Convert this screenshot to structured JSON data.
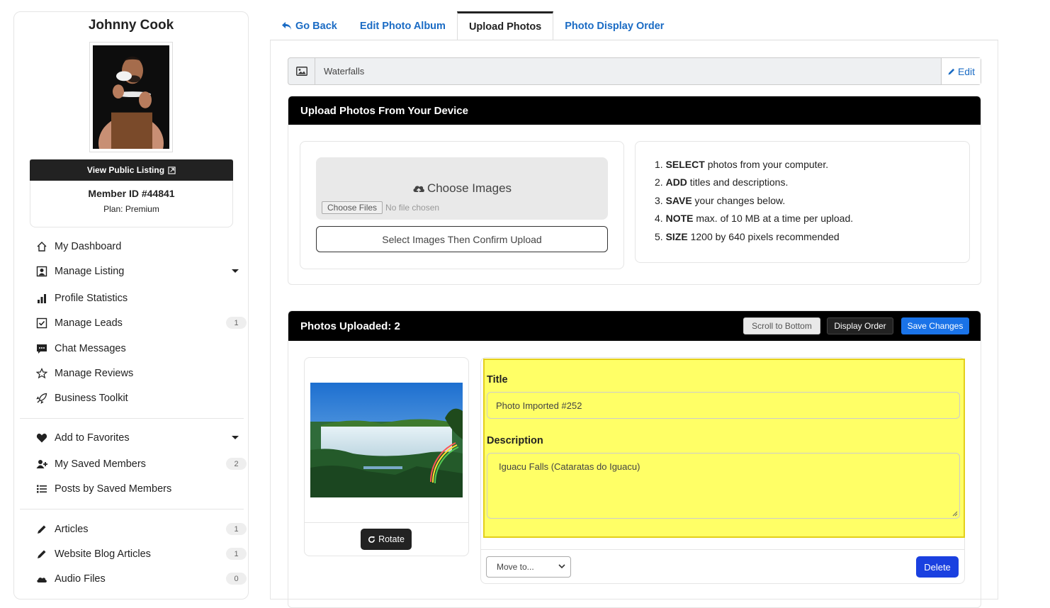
{
  "sidebar": {
    "member_name": "Johnny Cook",
    "view_public_label": "View Public Listing",
    "member_id": "Member ID #44841",
    "plan": "Plan: Premium",
    "nav": [
      {
        "label": "My Dashboard",
        "icon": "home-icon"
      },
      {
        "label": "Manage Listing",
        "icon": "user-icon",
        "dropdown": true
      },
      {
        "label": "Profile Statistics",
        "icon": "bar-chart-icon"
      },
      {
        "label": "Manage Leads",
        "icon": "checkbox-icon",
        "badge": "1"
      },
      {
        "label": "Chat Messages",
        "icon": "chat-icon"
      },
      {
        "label": "Manage Reviews",
        "icon": "star-icon"
      },
      {
        "label": "Business Toolkit",
        "icon": "rocket-icon"
      },
      {
        "label": "Add to Favorites",
        "icon": "heart-icon",
        "dropdown": true
      },
      {
        "label": "My Saved Members",
        "icon": "user-plus-icon",
        "badge": "2"
      },
      {
        "label": "Posts by Saved Members",
        "icon": "list-icon"
      },
      {
        "label": "Articles",
        "icon": "pencil-icon",
        "badge": "1"
      },
      {
        "label": "Website Blog Articles",
        "icon": "pencil-icon",
        "badge": "1"
      },
      {
        "label": "Audio Files",
        "icon": "cloud-icon",
        "badge": "0"
      }
    ]
  },
  "tabs": [
    {
      "label": "Go Back",
      "icon": "reply-arrow-icon"
    },
    {
      "label": "Edit Photo Album"
    },
    {
      "label": "Upload Photos",
      "active": true
    },
    {
      "label": "Photo Display Order"
    }
  ],
  "album": {
    "name": "Waterfalls",
    "edit_label": "Edit"
  },
  "upload": {
    "header": "Upload Photos From Your Device",
    "choose_images": "Choose Images",
    "choose_files_btn": "Choose Files",
    "no_file": "No file chosen",
    "confirm_btn": "Select Images Then Confirm Upload",
    "instructions": [
      {
        "num": "1.",
        "bold": "SELECT",
        "text": " photos from your computer."
      },
      {
        "num": "2.",
        "bold": "ADD",
        "text": " titles and descriptions."
      },
      {
        "num": "3.",
        "bold": "SAVE",
        "text": " your changes below."
      },
      {
        "num": "4.",
        "bold": "NOTE",
        "text": " max. of 10 MB at a time per upload."
      },
      {
        "num": "5.",
        "bold": "SIZE",
        "text": " 1200 by 640 pixels recommended"
      }
    ]
  },
  "photos": {
    "header": "Photos Uploaded: 2",
    "scroll_btn": "Scroll to Bottom",
    "order_btn": "Display Order",
    "save_btn": "Save Changes",
    "rotate_btn": "Rotate",
    "title_label": "Title",
    "title_value": "Photo Imported #252",
    "description_label": "Description",
    "description_value": "Iguacu Falls (Cataratas do Iguacu)",
    "move_select": "Move to...",
    "delete_btn": "Delete"
  },
  "colors": {
    "link": "#1a6bc4",
    "highlight": "#ffff66",
    "save": "#1a73e8",
    "delete": "#1a40e0"
  }
}
